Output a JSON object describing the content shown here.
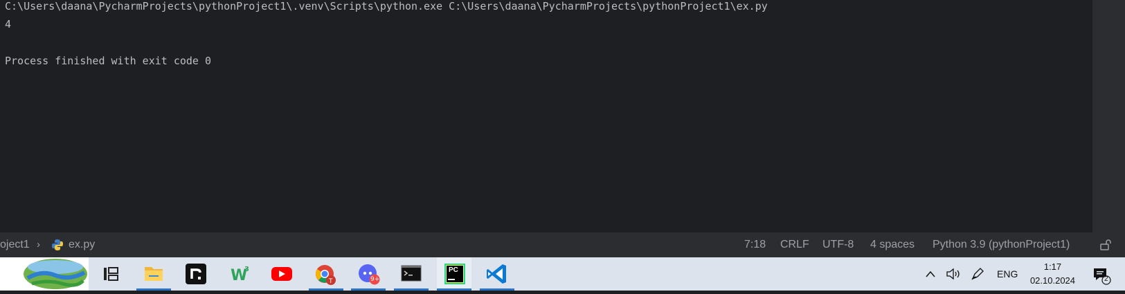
{
  "console": {
    "lines": [
      "C:\\Users\\daana\\PycharmProjects\\pythonProject1\\.venv\\Scripts\\python.exe C:\\Users\\daana\\PycharmProjects\\pythonProject1\\ex.py",
      "4",
      "",
      "Process finished with exit code 0"
    ]
  },
  "statusbar": {
    "breadcrumb_project": "oject1",
    "breadcrumb_sep": "›",
    "file_name": "ex.py",
    "position": "7:18",
    "line_separator": "CRLF",
    "encoding": "UTF-8",
    "indent": "4 spaces",
    "interpreter": "Python 3.9 (pythonProject1)"
  },
  "taskbar": {
    "apps": [
      {
        "name": "task-view-icon"
      },
      {
        "name": "file-explorer-icon"
      },
      {
        "name": "r-app-icon"
      },
      {
        "name": "w3-app-icon"
      },
      {
        "name": "youtube-icon"
      },
      {
        "name": "chrome-icon"
      },
      {
        "name": "discord-icon",
        "badge": "9+"
      },
      {
        "name": "terminal-icon"
      },
      {
        "name": "pycharm-icon",
        "label": "PC"
      },
      {
        "name": "vscode-icon"
      }
    ],
    "tray": {
      "language": "ENG",
      "time": "1:17",
      "date": "02.10.2024",
      "notification_count": "2"
    }
  },
  "colors": {
    "console_bg": "#1e1f22",
    "console_text": "#bcbec4",
    "statusbar_bg": "#2b2d30",
    "taskbar_bg": "#dde3ec",
    "active_indicator": "#2a73c9"
  }
}
